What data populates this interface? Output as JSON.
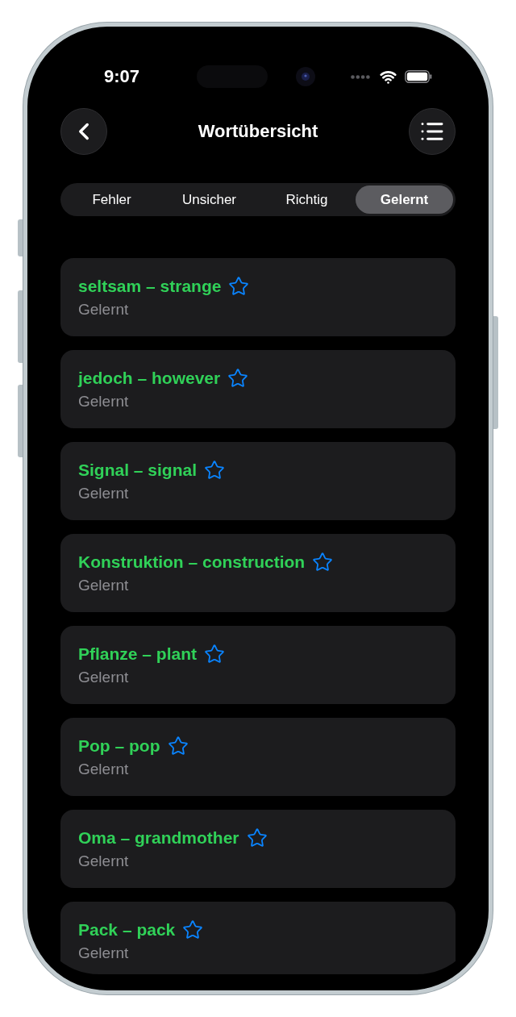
{
  "status_bar": {
    "time": "9:07"
  },
  "nav": {
    "title": "Wortübersicht"
  },
  "tabs": [
    {
      "label": "Fehler",
      "selected": false
    },
    {
      "label": "Unsicher",
      "selected": false
    },
    {
      "label": "Richtig",
      "selected": false
    },
    {
      "label": "Gelernt",
      "selected": true
    }
  ],
  "words": [
    {
      "term": "seltsam – strange",
      "status": "Gelernt",
      "starred": false
    },
    {
      "term": "jedoch – however",
      "status": "Gelernt",
      "starred": false
    },
    {
      "term": "Signal – signal",
      "status": "Gelernt",
      "starred": false
    },
    {
      "term": "Konstruktion – construction",
      "status": "Gelernt",
      "starred": false
    },
    {
      "term": "Pflanze – plant",
      "status": "Gelernt",
      "starred": false
    },
    {
      "term": "Pop – pop",
      "status": "Gelernt",
      "starred": false
    },
    {
      "term": "Oma – grandmother",
      "status": "Gelernt",
      "starred": false
    },
    {
      "term": "Pack – pack",
      "status": "Gelernt",
      "starred": false
    }
  ]
}
